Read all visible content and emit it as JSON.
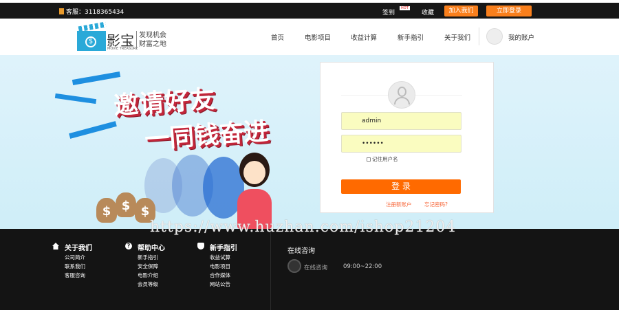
{
  "topbar": {
    "phone": "客服：3118365434",
    "checkin": "签到",
    "hot": "HOT",
    "favorite": "收藏",
    "join": "加入我们",
    "login_now": "立即登录"
  },
  "header": {
    "brand": "影宝",
    "brand_en": "MOVIE TREASURE",
    "slogan1": "发现机会",
    "slogan2": "财富之地",
    "nav": [
      "首页",
      "电影项目",
      "收益计算",
      "新手指引",
      "关于我们"
    ],
    "account": "我的账户"
  },
  "banner": {
    "line1": "邀请好友",
    "line2": "一同钱奋进"
  },
  "login": {
    "username": "admin",
    "password": "••••••",
    "remember": "记住用户名",
    "submit": "登 录",
    "register": "注册新账户",
    "forgot": "忘记密码?"
  },
  "watermark": "https://www.huzhan.com/ishop21204",
  "footer": {
    "cols": [
      {
        "title": "关于我们",
        "icon": "home-icon",
        "items": [
          "公司简介",
          "联系我们",
          "客服咨询"
        ]
      },
      {
        "title": "帮助中心",
        "icon": "help-icon",
        "items": [
          "新手指引",
          "安全保障",
          "电影介绍",
          "会员等级"
        ]
      },
      {
        "title": "新手指引",
        "icon": "shield-icon",
        "items": [
          "收益试算",
          "电影项目",
          "合作媒体",
          "网站公告"
        ]
      }
    ],
    "online_title": "在线咨询",
    "online_label": "在线咨询",
    "hours": "09:00~22:00"
  }
}
